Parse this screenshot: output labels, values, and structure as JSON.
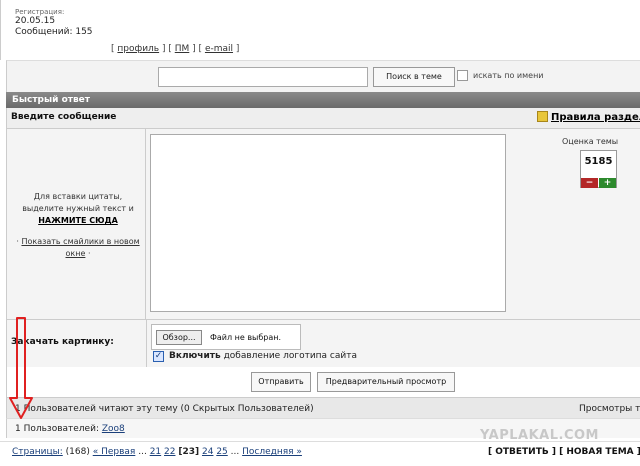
{
  "top": {
    "reg_label": "Регистрация:",
    "reg_date": "20.05.15",
    "messages": "Сообщений: 155",
    "links": {
      "open": "[",
      "profile": "профиль",
      "sep1": "] [",
      "pm": "ПМ",
      "sep2": "] [",
      "email": "e-mail",
      "close": "]"
    }
  },
  "search": {
    "button_label": "Поиск в теме",
    "by_name_label": "искать по имени"
  },
  "quick_reply": {
    "title": "Быстрый ответ",
    "enter_message": "Введите сообщение",
    "rules_link": "Правила раздела",
    "hint_line1": "Для вставки цитаты,",
    "hint_line2": "выделите нужный текст и",
    "hint_link": "НАЖМИТЕ СЮДА",
    "smileys_prefix": "·",
    "smileys_link": "Показать смайлики в новом окне",
    "smileys_suffix": "·",
    "rating_label": "Оценка темы",
    "rating_value": "5185",
    "rating_minus": "−",
    "rating_plus": "+"
  },
  "upload": {
    "label": "Закачать картинку:",
    "browse_label": "Обзор...",
    "file_status": "Файл не выбран.",
    "logo_bold": "Включить",
    "logo_rest": " добавление логотипа сайта",
    "logo_checked": true
  },
  "buttons": {
    "send": "Отправить",
    "preview": "Предварительный просмотр"
  },
  "readers": {
    "text": "1 Пользователей читают эту тему (0 Скрытых Пользователей)",
    "views": "Просмотры те"
  },
  "users": {
    "prefix": "1 Пользователей:",
    "user": "Zoo8"
  },
  "watermark": "YAPLAKAL.COM",
  "pagination": {
    "label": "Страницы:",
    "count": "(168)",
    "first": "« Первая",
    "ellipsis1": "...",
    "p21": "21",
    "p22": "22",
    "p23": "[23]",
    "p24": "24",
    "p25": "25",
    "ellipsis2": "...",
    "last": "Последняя »"
  },
  "actions": {
    "reply": "[ ОТВЕТИТЬ ]",
    "new_topic": "[ НОВАЯ ТЕМА ]"
  },
  "colors": {
    "header_bar": "#777777",
    "arrow": "#e02020",
    "link": "#1a3f7a"
  }
}
